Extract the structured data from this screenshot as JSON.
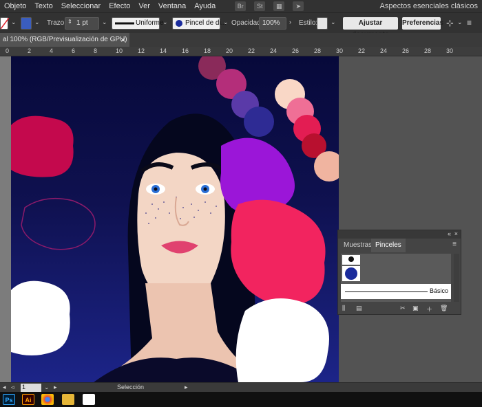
{
  "menu": [
    "Objeto",
    "Texto",
    "Seleccionar",
    "Efecto",
    "Ver",
    "Ventana",
    "Ayuda"
  ],
  "app_icons": [
    "Br",
    "St"
  ],
  "workspace": "Aspectos esenciales clásicos",
  "control": {
    "trazo_label": "Trazo:",
    "stroke_weight": "1 pt",
    "profile": "Uniforme",
    "brush": "Pincel de di...",
    "opacity_label": "Opacidad:",
    "opacity": "100%",
    "style_label": "Estilo:",
    "fit_button": "Ajustar documento",
    "prefs_button": "Preferencias",
    "fill_color": "#ffffff",
    "brush_color": "#1a2b9c"
  },
  "document_tab": "al 100% (RGB/Previsualización de GPU)",
  "ruler": [
    "0",
    "2",
    "4",
    "6",
    "8",
    "10",
    "12",
    "14",
    "16",
    "18",
    "20",
    "22",
    "24",
    "26",
    "28",
    "30"
  ],
  "panel": {
    "tabs": [
      "Muestras",
      "Pinceles"
    ],
    "brush_name": "Básico"
  },
  "status": {
    "artboard_number": "1",
    "tool": "Selección"
  },
  "taskbar": [
    "Ps",
    "Ai",
    "chrome-icon",
    "folder-icon",
    "photos-icon"
  ]
}
